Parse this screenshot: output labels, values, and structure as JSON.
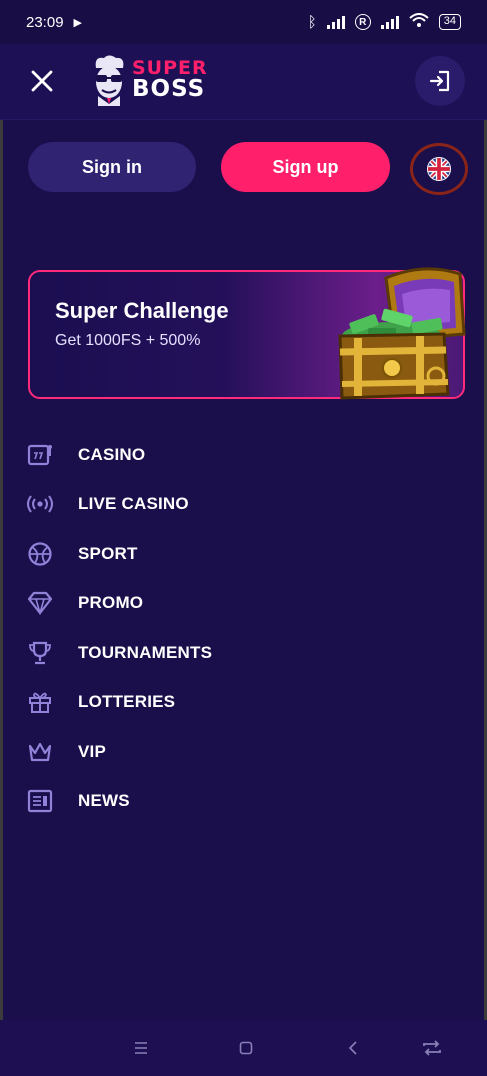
{
  "status_bar": {
    "time": "23:09",
    "battery": "34",
    "roaming_mark": "R"
  },
  "header": {
    "logo_top": "SUPER",
    "logo_bottom": "BOSS"
  },
  "auth": {
    "signin_label": "Sign in",
    "signup_label": "Sign up"
  },
  "banner": {
    "title": "Super Challenge",
    "subtitle": "Get 1000FS + 500%"
  },
  "menu": {
    "items": [
      {
        "label": "CASINO",
        "icon": "slot-machine-icon"
      },
      {
        "label": "LIVE CASINO",
        "icon": "broadcast-icon"
      },
      {
        "label": "SPORT",
        "icon": "basketball-icon"
      },
      {
        "label": "PROMO",
        "icon": "diamond-icon"
      },
      {
        "label": "TOURNAMENTS",
        "icon": "trophy-icon"
      },
      {
        "label": "LOTTERIES",
        "icon": "gift-icon"
      },
      {
        "label": "VIP",
        "icon": "crown-icon"
      },
      {
        "label": "NEWS",
        "icon": "newspaper-icon"
      }
    ]
  },
  "colors": {
    "background": "#1a0f4a",
    "accent": "#ff1f6a",
    "icon": "#8f82d8"
  }
}
